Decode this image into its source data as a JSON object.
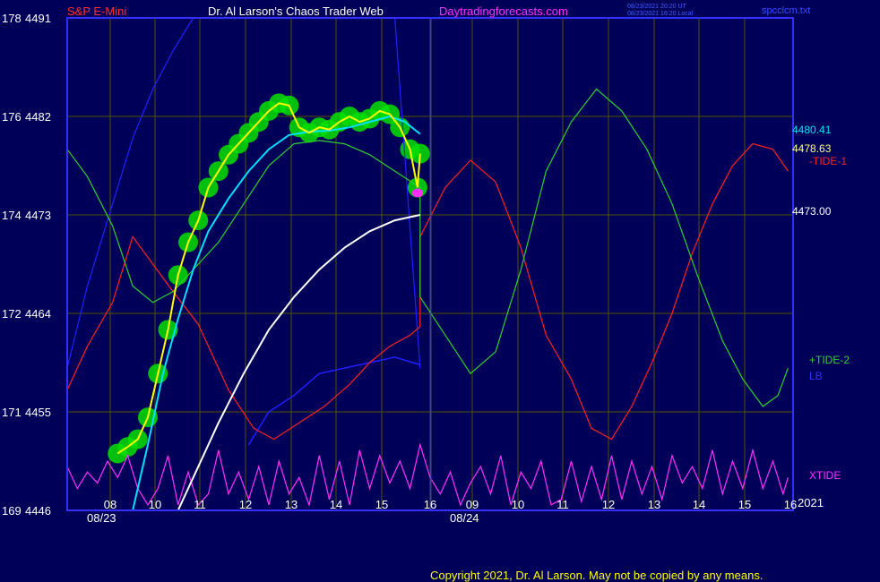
{
  "header": {
    "instrument": "S&P E-Mini",
    "site_title": "Dr. Al Larson's Chaos Trader Web",
    "site_url": "Daytradingforecasts.com",
    "timestamp_1": "08/23/2021 20:20 UT",
    "timestamp_2": "08/23/2021 16:20 Local",
    "filename": "spcclcm.txt"
  },
  "footer": {
    "copyright": "Copyright 2021, Dr. Al Larson. May not be copied by any means."
  },
  "colors": {
    "background": "#000058",
    "grid": "#555500",
    "frame": "#3030ff",
    "price": "#ffff00",
    "ema_cyan": "#00e0ff",
    "ema_white": "#ffffff",
    "tide_red": "#ff2020",
    "tide_green": "#30d030",
    "lb_blue": "#2020ff",
    "xtide": "#ff30ff",
    "highlight": "#00e000"
  },
  "chart_data": {
    "type": "line",
    "x_ticks": [
      "08",
      "10",
      "11",
      "12",
      "13",
      "14",
      "15",
      "16",
      "09",
      "10",
      "11",
      "12",
      "13",
      "14",
      "15",
      "16"
    ],
    "dates": [
      "08/23",
      "08/24"
    ],
    "year_label": "2021",
    "y_left_ticks": [
      {
        "index": "178",
        "price": "4491"
      },
      {
        "index": "176",
        "price": "4482"
      },
      {
        "index": "174",
        "price": "4473"
      },
      {
        "index": "172",
        "price": "4464"
      },
      {
        "index": "171",
        "price": "4455"
      },
      {
        "index": "169",
        "price": "4446"
      }
    ],
    "ylim": [
      4446,
      4491
    ],
    "right_labels": {
      "last_cyan": "4480.41",
      "last_price": "4478.63",
      "last_white": "4473.00",
      "tide1": "-TIDE-1",
      "tide2": "+TIDE-2",
      "lb": "LB",
      "xtide": "XTIDE"
    },
    "series": [
      {
        "name": "price",
        "values": [
          [
            8.0,
            4451.2
          ],
          [
            8.2,
            4451.8
          ],
          [
            8.4,
            4452.5
          ],
          [
            8.6,
            4454.5
          ],
          [
            8.8,
            4458.5
          ],
          [
            9.0,
            4462.5
          ],
          [
            9.2,
            4467.5
          ],
          [
            9.4,
            4470.5
          ],
          [
            9.6,
            4472.5
          ],
          [
            9.8,
            4475.5
          ],
          [
            10.0,
            4477.0
          ],
          [
            10.2,
            4478.5
          ],
          [
            10.4,
            4479.5
          ],
          [
            10.6,
            4480.5
          ],
          [
            10.8,
            4481.5
          ],
          [
            11.0,
            4482.5
          ],
          [
            11.2,
            4483.2
          ],
          [
            11.4,
            4483.0
          ],
          [
            11.6,
            4481.0
          ],
          [
            11.8,
            4480.5
          ],
          [
            12.0,
            4481.0
          ],
          [
            12.2,
            4480.8
          ],
          [
            12.4,
            4481.5
          ],
          [
            12.6,
            4482.0
          ],
          [
            12.8,
            4481.5
          ],
          [
            13.0,
            4481.8
          ],
          [
            13.2,
            4482.5
          ],
          [
            13.4,
            4482.2
          ],
          [
            13.6,
            4481.0
          ],
          [
            13.8,
            4479.0
          ],
          [
            13.95,
            4475.5
          ],
          [
            14.0,
            4478.6
          ]
        ]
      },
      {
        "name": "cyan",
        "values": [
          [
            8.3,
            4446.0
          ],
          [
            8.6,
            4452.0
          ],
          [
            8.9,
            4458.5
          ],
          [
            9.2,
            4463.5
          ],
          [
            9.5,
            4468.0
          ],
          [
            9.8,
            4471.5
          ],
          [
            10.2,
            4474.5
          ],
          [
            10.6,
            4477.0
          ],
          [
            11.0,
            4479.0
          ],
          [
            11.4,
            4480.3
          ],
          [
            11.8,
            4480.6
          ],
          [
            12.2,
            4480.7
          ],
          [
            12.6,
            4481.0
          ],
          [
            13.0,
            4481.5
          ],
          [
            13.4,
            4482.0
          ],
          [
            13.7,
            4481.5
          ],
          [
            14.0,
            4480.4
          ]
        ]
      },
      {
        "name": "white",
        "values": [
          [
            9.2,
            4446.0
          ],
          [
            9.6,
            4450.0
          ],
          [
            10.0,
            4454.0
          ],
          [
            10.5,
            4458.5
          ],
          [
            11.0,
            4462.5
          ],
          [
            11.5,
            4465.5
          ],
          [
            12.0,
            4468.0
          ],
          [
            12.5,
            4470.0
          ],
          [
            13.0,
            4471.5
          ],
          [
            13.5,
            4472.5
          ],
          [
            14.0,
            4473.0
          ]
        ]
      },
      {
        "name": "tide1",
        "values": [
          [
            7.0,
            4457.0
          ],
          [
            7.4,
            4461.0
          ],
          [
            7.9,
            4465.0
          ],
          [
            8.3,
            4471.0
          ],
          [
            8.7,
            4468.5
          ],
          [
            9.1,
            4466.0
          ],
          [
            9.6,
            4463.0
          ],
          [
            10.2,
            4457.0
          ],
          [
            10.7,
            4453.5
          ],
          [
            11.1,
            4452.5
          ],
          [
            11.6,
            4454.0
          ],
          [
            12.1,
            4455.5
          ],
          [
            12.6,
            4457.5
          ],
          [
            13.0,
            4459.5
          ],
          [
            13.4,
            4461.0
          ],
          [
            13.8,
            4462.0
          ],
          [
            14.0,
            4462.8
          ],
          [
            14.0,
            4471.0
          ],
          [
            14.5,
            4475.5
          ],
          [
            15.0,
            4478.0
          ],
          [
            15.5,
            4476.0
          ],
          [
            16.0,
            4470.0
          ],
          [
            16.5,
            4462.0
          ],
          [
            17.0,
            4458.0
          ],
          [
            17.4,
            4453.5
          ],
          [
            17.8,
            4452.5
          ],
          [
            18.2,
            4455.5
          ],
          [
            18.6,
            4459.5
          ],
          [
            19.0,
            4464.0
          ],
          [
            19.4,
            4469.5
          ],
          [
            19.8,
            4474.0
          ],
          [
            20.2,
            4477.5
          ],
          [
            20.6,
            4479.5
          ],
          [
            21.0,
            4479.0
          ],
          [
            21.3,
            4477.0
          ]
        ]
      },
      {
        "name": "tide2",
        "values": [
          [
            7.0,
            4479.0
          ],
          [
            7.4,
            4476.5
          ],
          [
            7.9,
            4472.0
          ],
          [
            8.3,
            4466.5
          ],
          [
            8.7,
            4465.0
          ],
          [
            9.1,
            4466.0
          ],
          [
            9.5,
            4468.0
          ],
          [
            10.0,
            4470.5
          ],
          [
            10.5,
            4474.0
          ],
          [
            11.0,
            4477.5
          ],
          [
            11.5,
            4479.5
          ],
          [
            12.0,
            4479.8
          ],
          [
            12.5,
            4479.5
          ],
          [
            13.0,
            4478.5
          ],
          [
            13.5,
            4477.0
          ],
          [
            14.0,
            4475.5
          ],
          [
            14.0,
            4465.5
          ],
          [
            14.5,
            4462.0
          ],
          [
            15.0,
            4458.5
          ],
          [
            15.5,
            4460.5
          ],
          [
            16.0,
            4468.0
          ],
          [
            16.5,
            4477.0
          ],
          [
            17.0,
            4481.5
          ],
          [
            17.5,
            4484.5
          ],
          [
            18.0,
            4482.5
          ],
          [
            18.5,
            4479.0
          ],
          [
            19.0,
            4474.0
          ],
          [
            19.5,
            4467.5
          ],
          [
            20.0,
            4461.5
          ],
          [
            20.4,
            4458.0
          ],
          [
            20.8,
            4455.5
          ],
          [
            21.1,
            4456.5
          ],
          [
            21.3,
            4459.0
          ]
        ]
      },
      {
        "name": "lb",
        "values": [
          [
            7.0,
            4459.0
          ],
          [
            7.4,
            4466.5
          ],
          [
            7.9,
            4474.0
          ],
          [
            8.3,
            4480.0
          ],
          [
            8.7,
            4484.5
          ],
          [
            9.1,
            4488.0
          ],
          [
            9.5,
            4491.0
          ],
          [
            10.0,
            4491.0
          ],
          [
            10.5,
            4491.0
          ],
          [
            11.0,
            4491.0
          ],
          [
            11.5,
            4491.0
          ],
          [
            12.0,
            4491.0
          ],
          [
            12.5,
            4491.0
          ],
          [
            13.0,
            4491.0
          ],
          [
            13.5,
            4491.0
          ],
          [
            14.0,
            4459.0
          ]
        ]
      },
      {
        "name": "lb_lower",
        "values": [
          [
            10.6,
            4452.0
          ],
          [
            11.0,
            4455.0
          ],
          [
            11.5,
            4456.5
          ],
          [
            12.0,
            4458.5
          ],
          [
            12.5,
            4459.0
          ],
          [
            13.0,
            4459.5
          ],
          [
            13.5,
            4460.0
          ],
          [
            14.0,
            4459.3
          ]
        ]
      },
      {
        "name": "xtide",
        "values": [
          [
            7.0,
            4450.0
          ],
          [
            7.2,
            4448.0
          ],
          [
            7.4,
            4449.5
          ],
          [
            7.6,
            4448.5
          ],
          [
            7.8,
            4450.5
          ],
          [
            8.0,
            4449.0
          ],
          [
            8.2,
            4451.0
          ],
          [
            8.4,
            4448.0
          ],
          [
            8.6,
            4446.5
          ],
          [
            8.8,
            4448.0
          ],
          [
            9.0,
            4451.0
          ],
          [
            9.2,
            4446.5
          ],
          [
            9.4,
            4449.5
          ],
          [
            9.6,
            4446.5
          ],
          [
            9.8,
            4447.5
          ],
          [
            10.0,
            4451.5
          ],
          [
            10.2,
            4447.5
          ],
          [
            10.4,
            4449.5
          ],
          [
            10.6,
            4447.0
          ],
          [
            10.8,
            4450.0
          ],
          [
            11.0,
            4446.5
          ],
          [
            11.2,
            4450.5
          ],
          [
            11.4,
            4447.5
          ],
          [
            11.6,
            4449.0
          ],
          [
            11.8,
            4446.5
          ],
          [
            12.0,
            4451.0
          ],
          [
            12.2,
            4447.0
          ],
          [
            12.4,
            4450.5
          ],
          [
            12.6,
            4446.5
          ],
          [
            12.8,
            4451.5
          ],
          [
            13.0,
            4448.0
          ],
          [
            13.2,
            4451.0
          ],
          [
            13.4,
            4448.5
          ],
          [
            13.6,
            4450.5
          ],
          [
            13.8,
            4448.0
          ],
          [
            14.0,
            4452.0
          ],
          [
            14.2,
            4449.0
          ],
          [
            14.4,
            4447.5
          ],
          [
            14.6,
            4449.5
          ],
          [
            14.8,
            4446.5
          ],
          [
            15.0,
            4448.5
          ],
          [
            15.2,
            4450.0
          ],
          [
            15.4,
            4447.5
          ],
          [
            15.6,
            4451.0
          ],
          [
            15.8,
            4446.5
          ],
          [
            16.0,
            4449.5
          ],
          [
            16.2,
            4448.0
          ],
          [
            16.4,
            4450.5
          ],
          [
            16.6,
            4446.5
          ],
          [
            16.8,
            4447.0
          ],
          [
            17.0,
            4450.5
          ],
          [
            17.2,
            4446.8
          ],
          [
            17.4,
            4450.0
          ],
          [
            17.6,
            4447.0
          ],
          [
            17.8,
            4451.0
          ],
          [
            18.0,
            4447.0
          ],
          [
            18.2,
            4450.5
          ],
          [
            18.4,
            4447.5
          ],
          [
            18.6,
            4450.0
          ],
          [
            18.8,
            4447.0
          ],
          [
            19.0,
            4451.0
          ],
          [
            19.2,
            4448.5
          ],
          [
            19.4,
            4450.0
          ],
          [
            19.6,
            4448.0
          ],
          [
            19.8,
            4451.5
          ],
          [
            20.0,
            4447.5
          ],
          [
            20.2,
            4450.5
          ],
          [
            20.4,
            4448.0
          ],
          [
            20.6,
            4451.5
          ],
          [
            20.8,
            4448.0
          ],
          [
            21.0,
            4450.5
          ],
          [
            21.2,
            4447.5
          ],
          [
            21.3,
            4449.0
          ]
        ]
      }
    ]
  }
}
